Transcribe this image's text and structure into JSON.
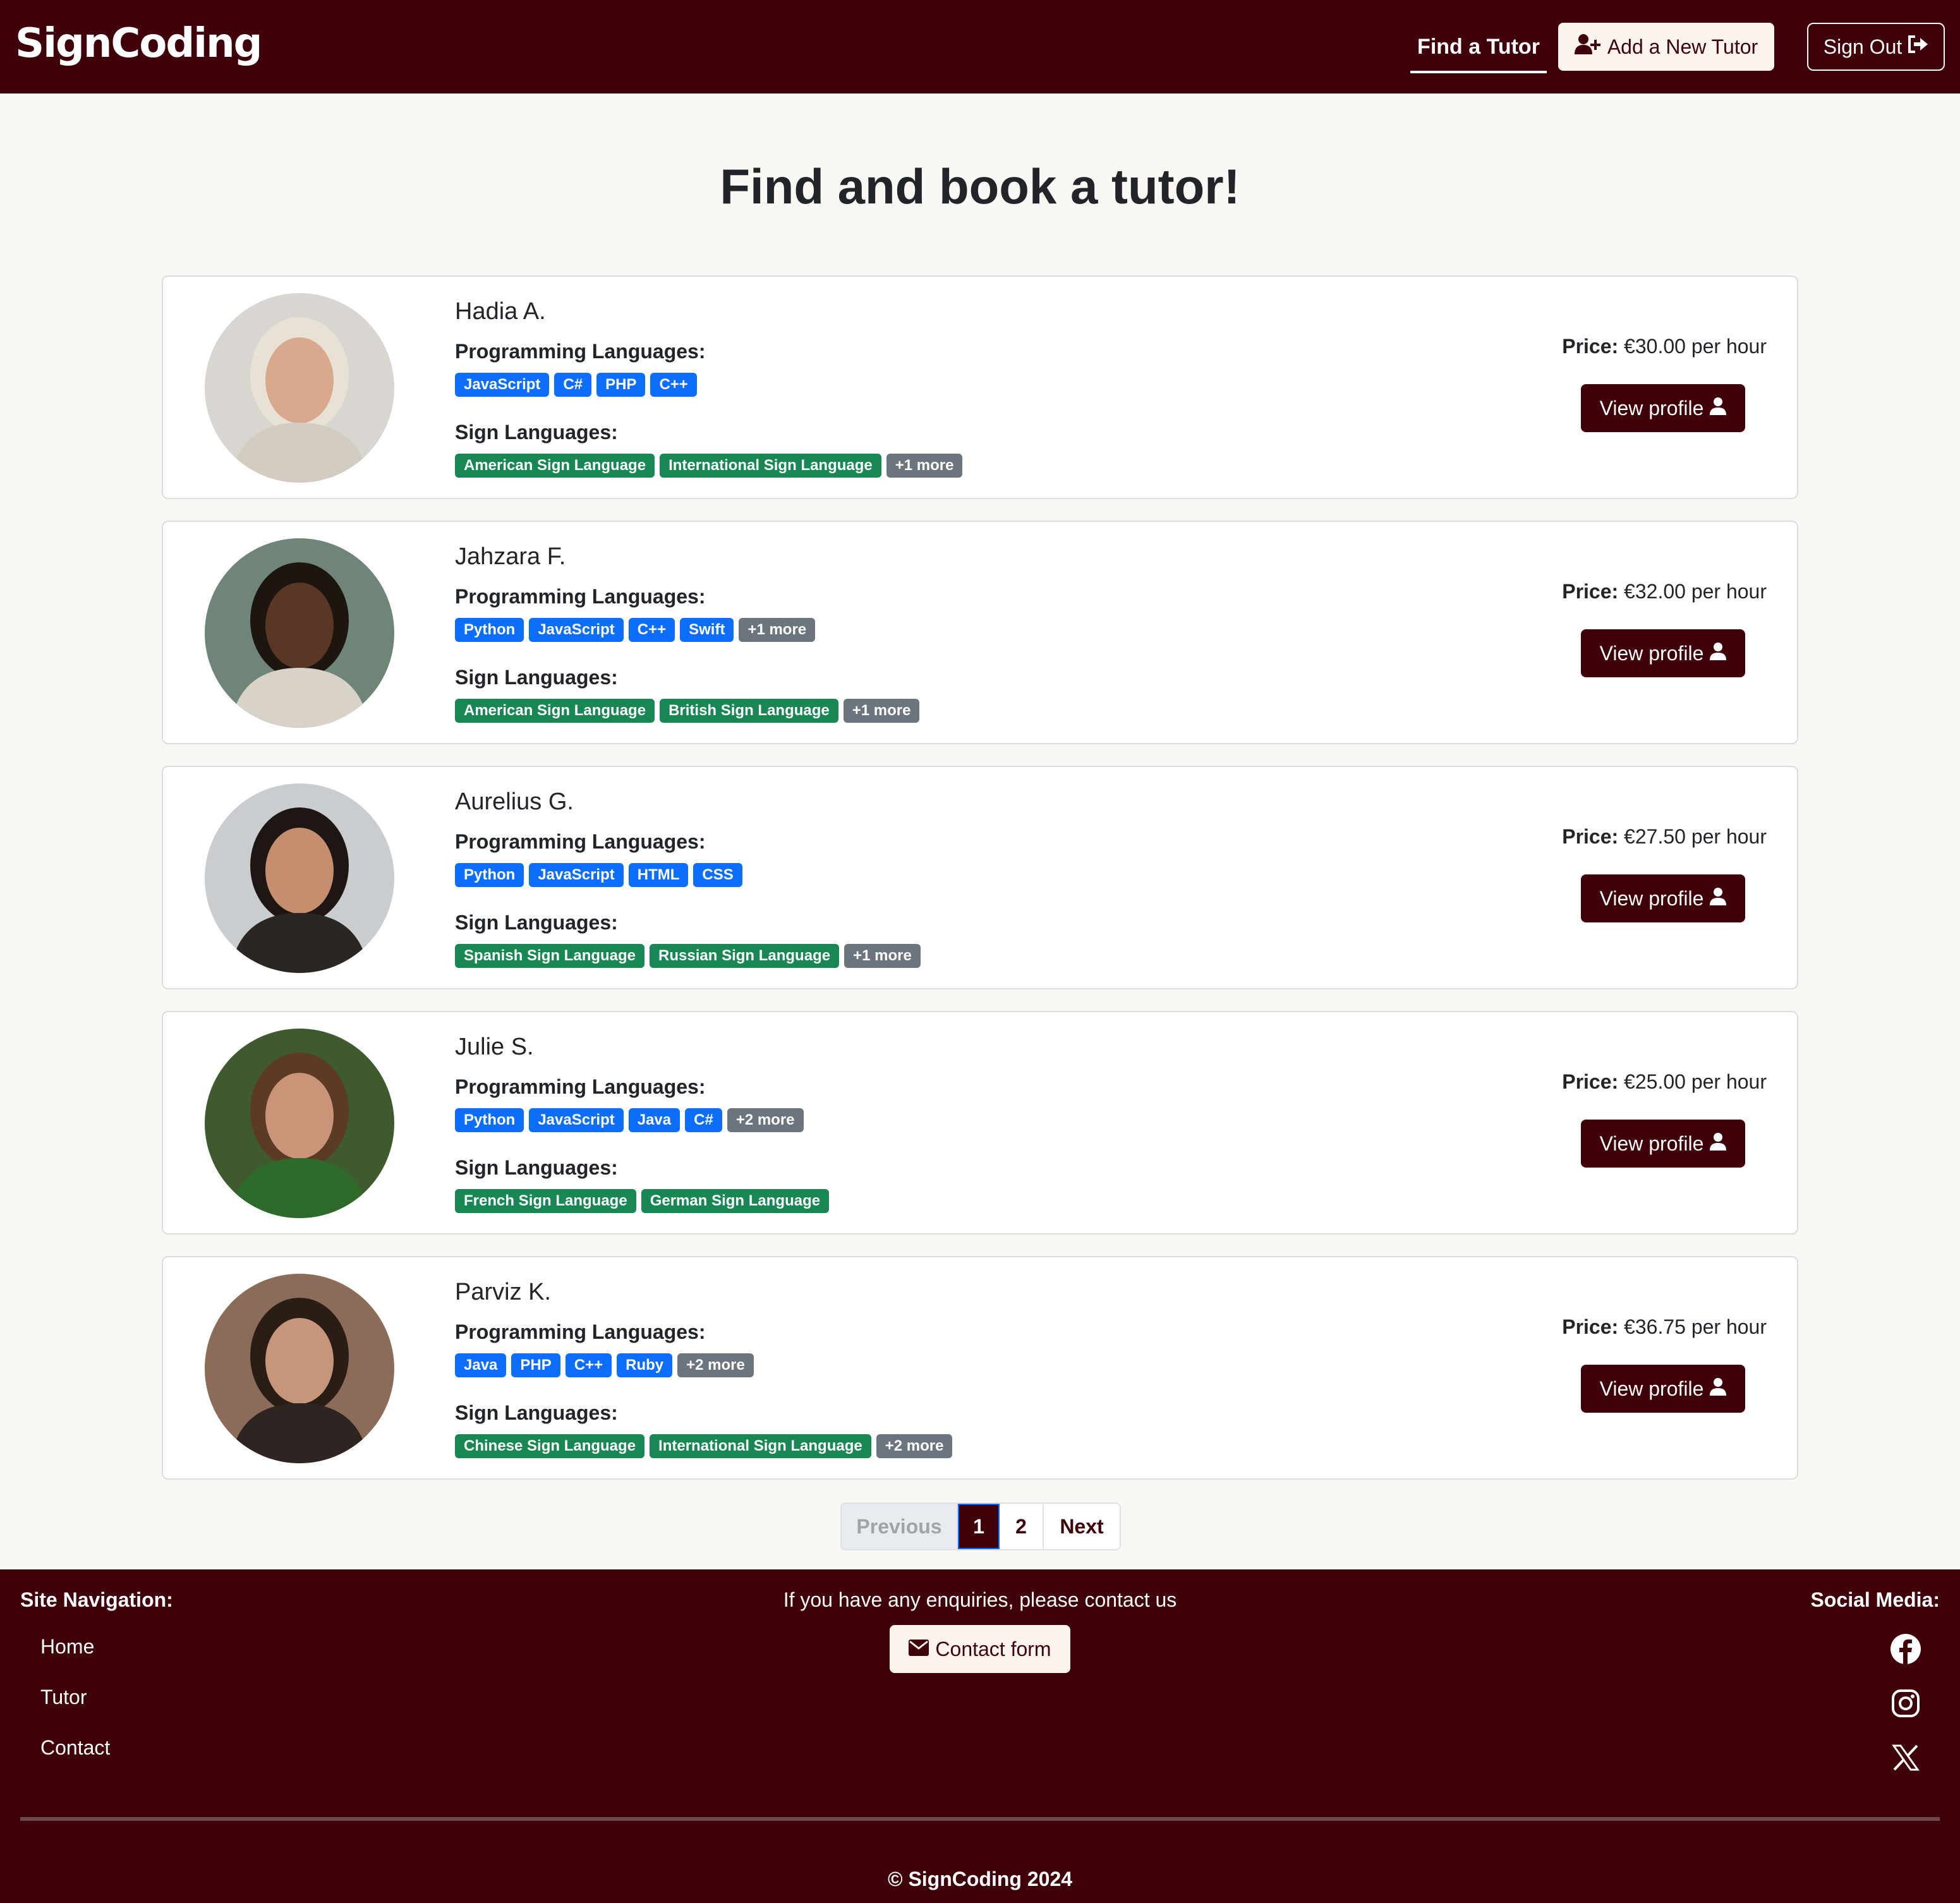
{
  "header": {
    "brand": "SignCoding",
    "nav_find": "Find a Tutor",
    "add_tutor": "Add a New Tutor",
    "sign_out": "Sign Out"
  },
  "main": {
    "title": "Find and book a tutor!",
    "prog_label": "Programming Languages:",
    "sign_label": "Sign Languages:",
    "price_label": "Price:",
    "view_profile": "View profile"
  },
  "tutors": [
    {
      "name": "Hadia A.",
      "price": "€30.00 per hour",
      "programming": [
        "JavaScript",
        "C#",
        "PHP",
        "C++"
      ],
      "programming_more": "",
      "sign": [
        "American Sign Language",
        "International Sign Language"
      ],
      "sign_more": "+1 more",
      "avatar": {
        "bg": "#d9d6d1",
        "skin": "#d8a98c",
        "hair": "#e8e1d6",
        "cloth": "#d2ccc3"
      }
    },
    {
      "name": "Jahzara F.",
      "price": "€32.00 per hour",
      "programming": [
        "Python",
        "JavaScript",
        "C++",
        "Swift"
      ],
      "programming_more": "+1 more",
      "sign": [
        "American Sign Language",
        "British Sign Language"
      ],
      "sign_more": "+1 more",
      "avatar": {
        "bg": "#6e8578",
        "skin": "#5a3625",
        "hair": "#1d1510",
        "cloth": "#d8d2c8"
      }
    },
    {
      "name": "Aurelius G.",
      "price": "€27.50 per hour",
      "programming": [
        "Python",
        "JavaScript",
        "HTML",
        "CSS"
      ],
      "programming_more": "",
      "sign": [
        "Spanish Sign Language",
        "Russian Sign Language"
      ],
      "sign_more": "+1 more",
      "avatar": {
        "bg": "#c9cdd0",
        "skin": "#c58e6f",
        "hair": "#1e1612",
        "cloth": "#2b2622"
      }
    },
    {
      "name": "Julie S.",
      "price": "€25.00 per hour",
      "programming": [
        "Python",
        "JavaScript",
        "Java",
        "C#"
      ],
      "programming_more": "+2 more",
      "sign": [
        "French Sign Language",
        "German Sign Language"
      ],
      "sign_more": "",
      "avatar": {
        "bg": "#3f5a2e",
        "skin": "#c99478",
        "hair": "#5b3a26",
        "cloth": "#2e6b2a"
      }
    },
    {
      "name": "Parviz K.",
      "price": "€36.75 per hour",
      "programming": [
        "Java",
        "PHP",
        "C++",
        "Ruby"
      ],
      "programming_more": "+2 more",
      "sign": [
        "Chinese Sign Language",
        "International Sign Language"
      ],
      "sign_more": "+2 more",
      "avatar": {
        "bg": "#8a6c58",
        "skin": "#c7967a",
        "hair": "#2a1d16",
        "cloth": "#2e2522"
      }
    }
  ],
  "pagination": {
    "previous": "Previous",
    "page1": "1",
    "page2": "2",
    "next": "Next"
  },
  "footer": {
    "nav_title": "Site Navigation:",
    "links": [
      "Home",
      "Tutor",
      "Contact"
    ],
    "enquiry": "If you have any enquiries, please contact us",
    "contact_button": "Contact form",
    "social_title": "Social Media:",
    "social_icons": [
      "facebook-icon",
      "instagram-icon",
      "x-icon"
    ],
    "copyright": "© SignCoding 2024"
  },
  "colors": {
    "brand": "#3f000a",
    "badge_blue": "#0d6efd",
    "badge_green": "#198754",
    "badge_gray": "#6c757d"
  }
}
